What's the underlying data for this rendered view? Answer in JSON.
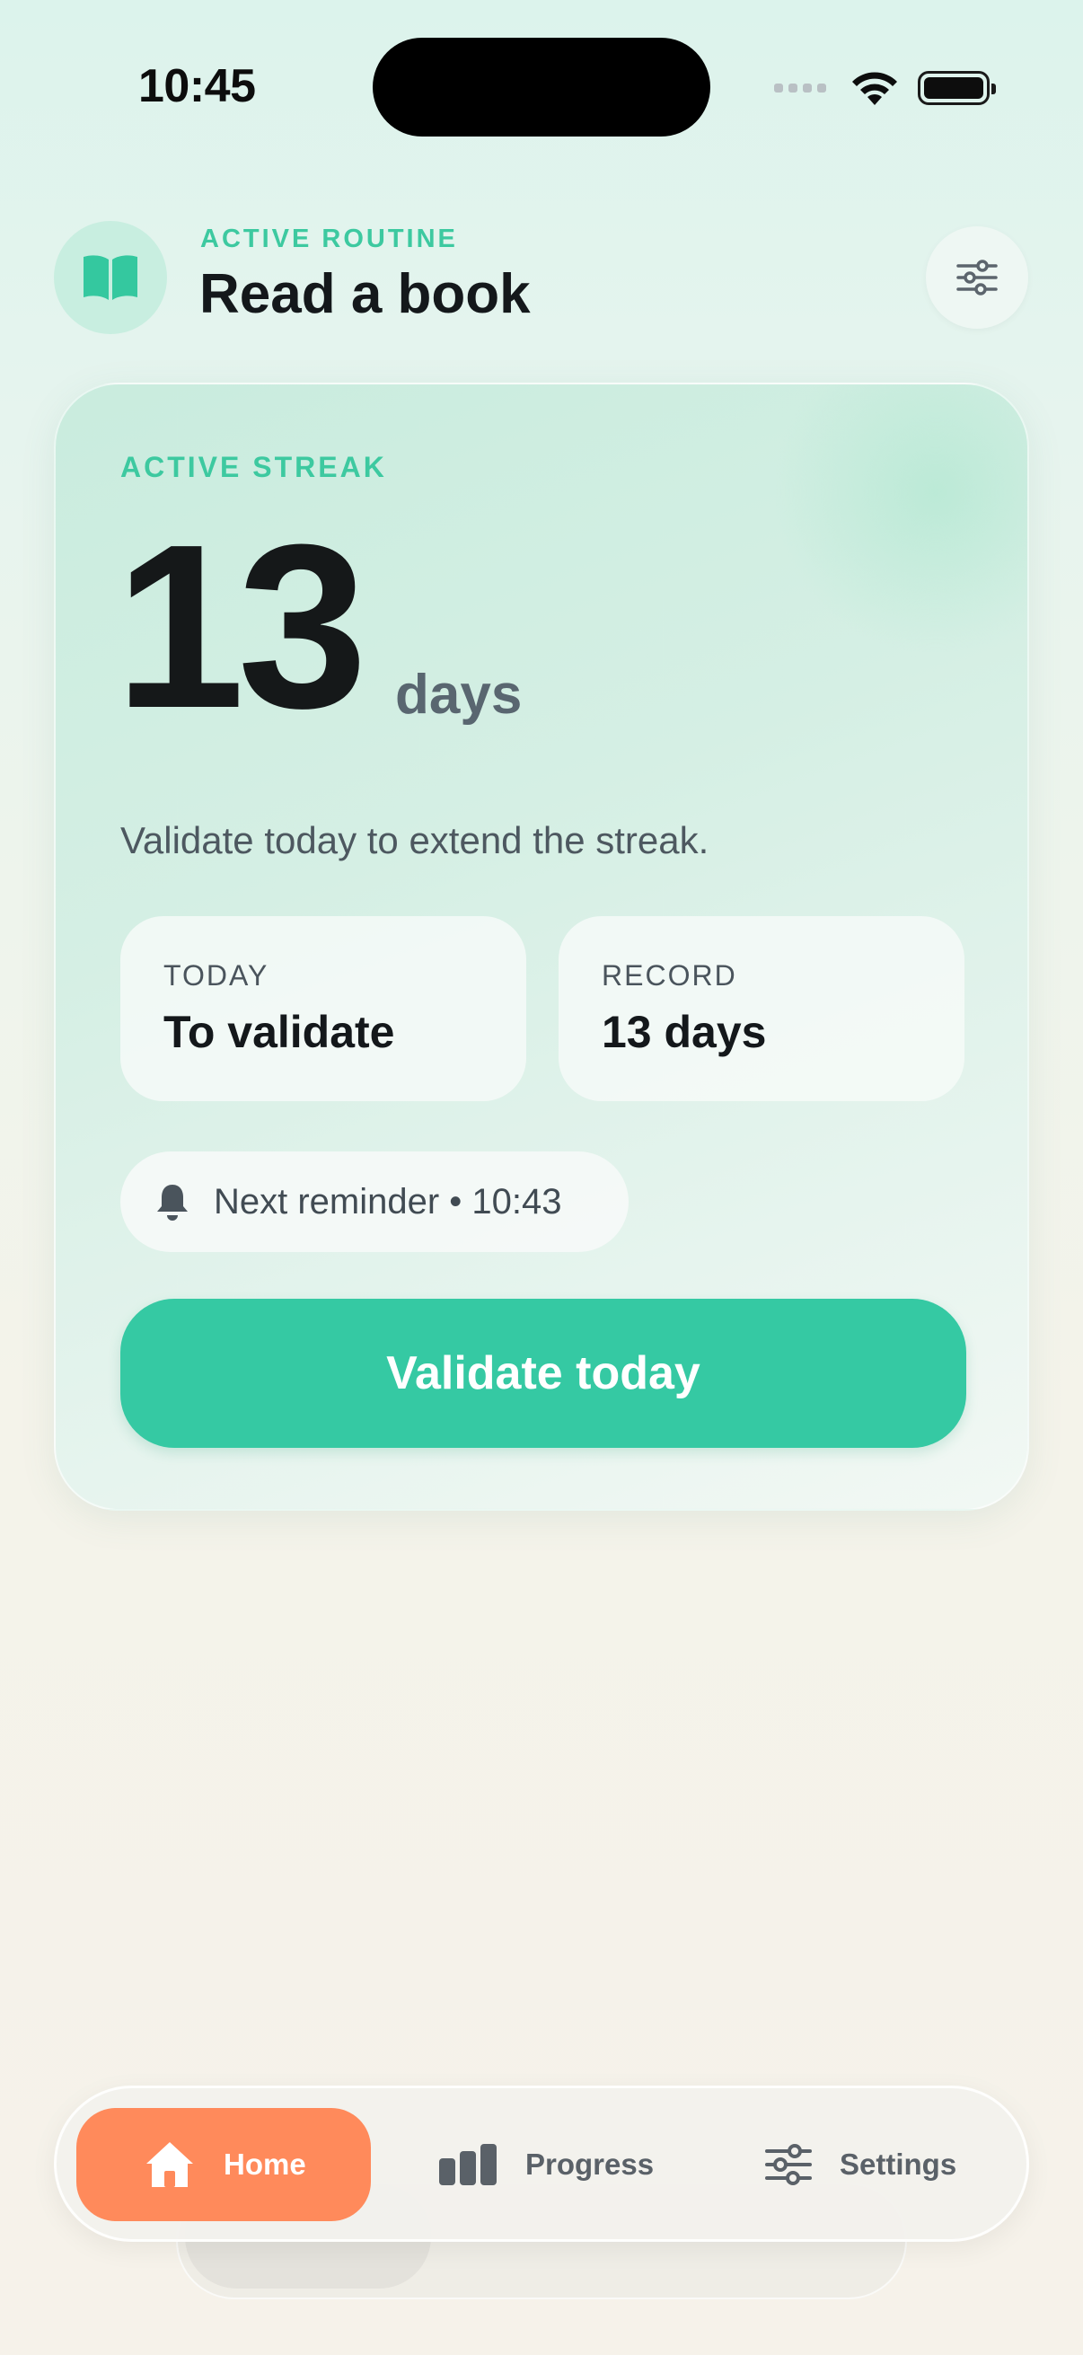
{
  "status_bar": {
    "time": "10:45"
  },
  "header": {
    "kicker": "ACTIVE ROUTINE",
    "title": "Read a book",
    "icon": "open-book-icon",
    "filter_icon": "sliders-icon"
  },
  "streak_card": {
    "kicker": "ACTIVE STREAK",
    "count": "13",
    "unit": "days",
    "subtitle": "Validate today to extend the streak.",
    "today": {
      "label": "TODAY",
      "value": "To validate"
    },
    "record": {
      "label": "RECORD",
      "value": "13 days"
    },
    "reminder": "Next reminder • 10:43",
    "validate_label": "Validate today"
  },
  "tabs": [
    {
      "label": "Home",
      "icon": "home-icon",
      "active": true
    },
    {
      "label": "Progress",
      "icon": "bar-chart-icon",
      "active": false
    },
    {
      "label": "Settings",
      "icon": "sliders-icon",
      "active": false
    }
  ],
  "colors": {
    "accent_green": "#35c9a3",
    "kicker_green": "#3dc9a0",
    "active_tab": "#ff8a5b"
  }
}
